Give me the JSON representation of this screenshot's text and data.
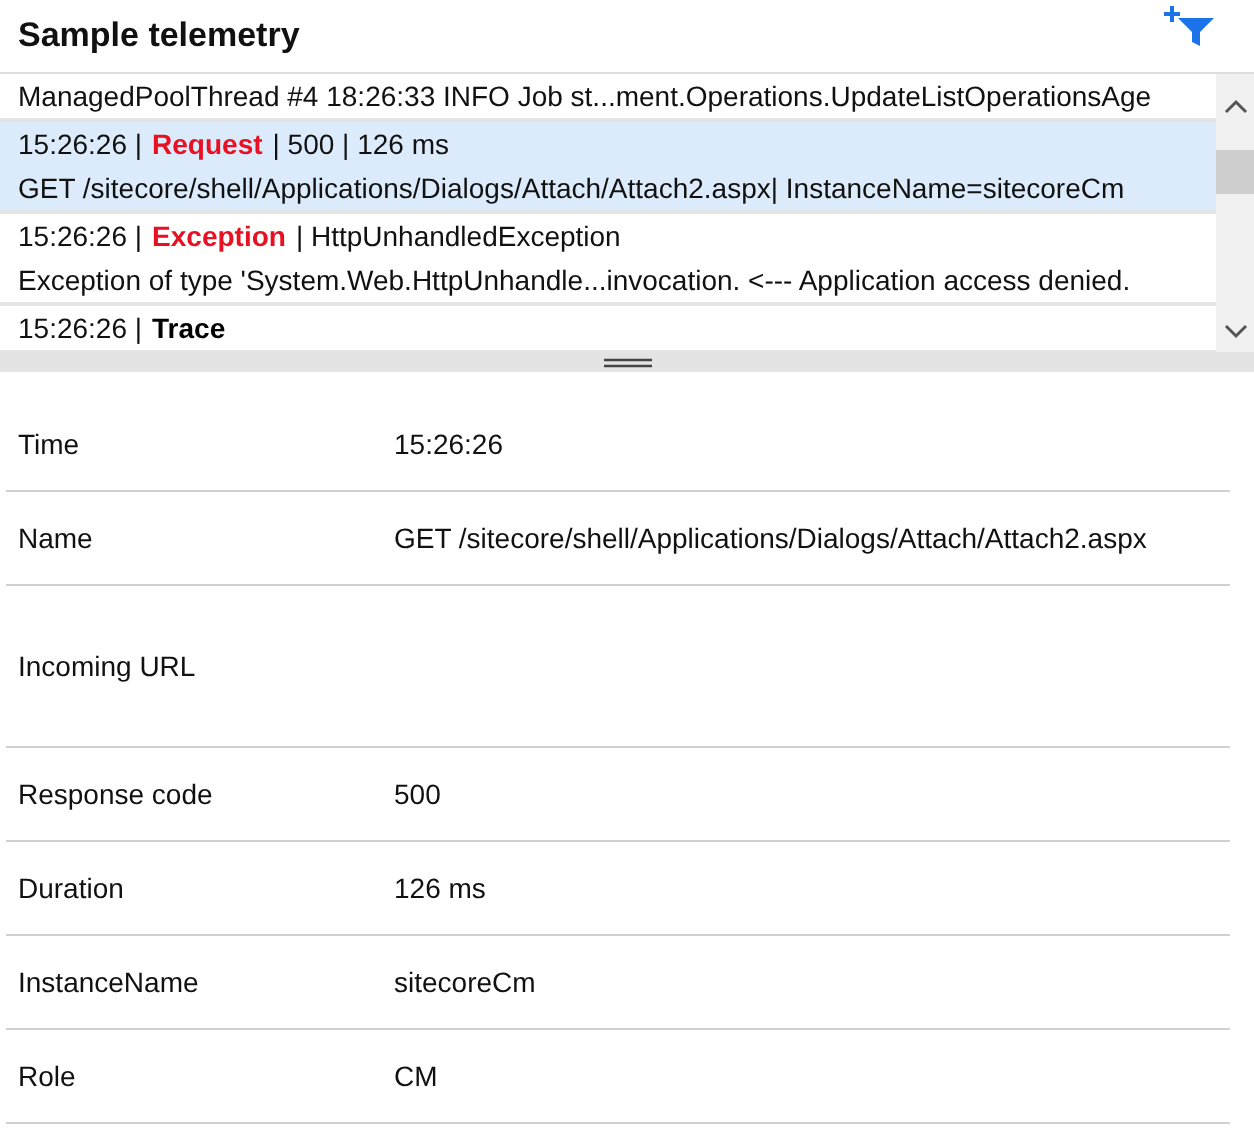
{
  "title": "Sample telemetry",
  "entries": [
    {
      "selected": false,
      "lines": [
        {
          "kind": "plain",
          "text": "ManagedPoolThread #4 18:26:33 INFO Job st...ment.Operations.UpdateListOperationsAge"
        }
      ]
    },
    {
      "selected": true,
      "lines": [
        {
          "kind": "header",
          "time": "15:26:26 |",
          "type": "Request",
          "color": "#e81123",
          "rest": "| 500  | 126 ms"
        },
        {
          "kind": "plain",
          "text": "GET /sitecore/shell/Applications/Dialogs/Attach/Attach2.aspx| InstanceName=sitecoreCm"
        }
      ]
    },
    {
      "selected": false,
      "lines": [
        {
          "kind": "header",
          "time": "15:26:26 |",
          "type": "Exception",
          "color": "#e81123",
          "rest": "| HttpUnhandledException"
        },
        {
          "kind": "plain",
          "text": "Exception of type 'System.Web.HttpUnhandle...invocation. <--- Application access denied."
        }
      ]
    },
    {
      "selected": false,
      "lines": [
        {
          "kind": "header",
          "time": "15:26:26 |",
          "type": "Trace",
          "color": "#000000"
        }
      ]
    }
  ],
  "details": [
    {
      "label": "Time",
      "value": "15:26:26"
    },
    {
      "label": "Name",
      "value": "GET /sitecore/shell/Applications/Dialogs/Attach/Attach2.aspx"
    },
    {
      "label": "Incoming URL"
    },
    {
      "label": "Response code",
      "value": "500"
    },
    {
      "label": "Duration",
      "value": "126 ms"
    },
    {
      "label": "InstanceName",
      "value": "sitecoreCm"
    },
    {
      "label": "Role",
      "value": "CM"
    }
  ]
}
